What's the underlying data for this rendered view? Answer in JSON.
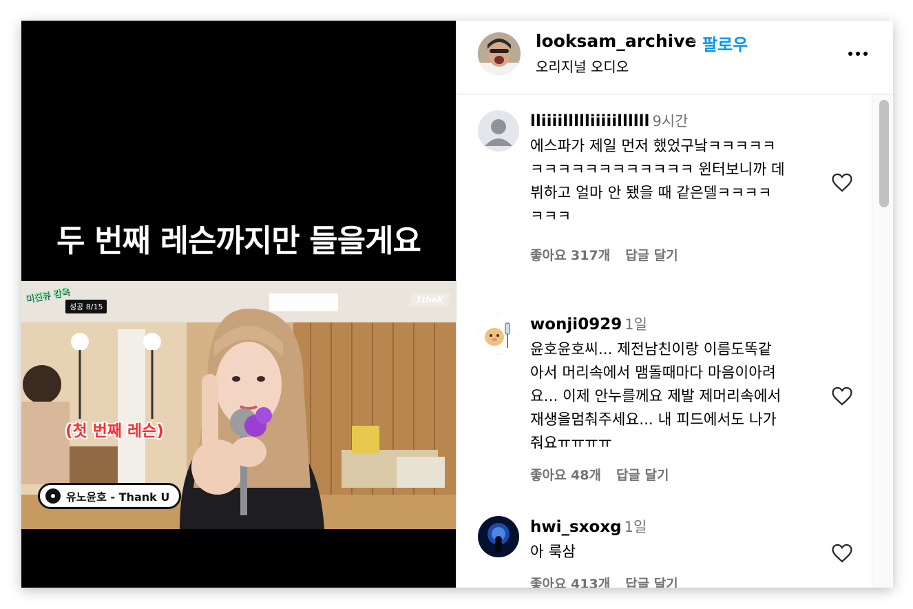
{
  "media": {
    "caption": "두 번째 레슨까지만 들을게요",
    "show_logo": "미친뷰 감옥",
    "success_badge": "성공 8/15",
    "channel_logo": "1theK",
    "lesson_tag": "(첫 번째 레슨)",
    "song": "유노윤호 - Thank U"
  },
  "header": {
    "username": "looksam_archive",
    "separator": "•",
    "follow_label": "팔로우",
    "subtitle": "오리지널 오디오"
  },
  "comments": [
    {
      "username": "lliiiillllliiiiillllll",
      "time": "9시간",
      "text": "에스파가 제일 먼저 했었구낰ㅋㅋㅋㅋㅋ\nㅋㅋㅋㅋㅋㅋㅋㅋㅋㅋㅋㅋ 윈터보니까 데\n뷔하고 얼마 안 됐을 때 같은델ㅋㅋㅋㅋ\nㅋㅋㅋ",
      "likes": "좋아요 317개",
      "reply_label": "답글 달기"
    },
    {
      "username": "wonji0929",
      "time": "1일",
      "text": "윤호윤호씨... 제전남친이랑 이름도똑같\n아서 머리속에서 맴돌때마다 마음이아려\n요... 이제 안누를께요 제발 제머리속에서\n재생을멈춰주세요... 내 피드에서도 나가\n줘요ㅠㅠㅠㅠ",
      "likes": "좋아요 48개",
      "reply_label": "답글 달기"
    },
    {
      "username": "hwi_sxoxg",
      "time": "1일",
      "text": "아 룩삼",
      "likes": "좋아요 413개",
      "reply_label": "답글 달기"
    }
  ],
  "colors": {
    "follow": "#0095f6",
    "muted": "#737373",
    "border": "#dbdbdb",
    "lesson_tag": "#ff2e2e"
  }
}
